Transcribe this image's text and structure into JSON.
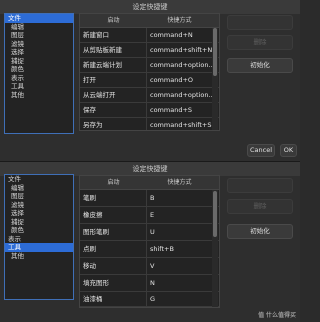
{
  "dialog1": {
    "title": "设定快捷键",
    "categories": [
      "文件",
      "编辑",
      "图层",
      "滤镜",
      "选择",
      "捕捉",
      "颜色",
      "表示",
      "工具",
      "其他"
    ],
    "header": {
      "col1": "启动",
      "col2": "快捷方式"
    },
    "rows": [
      {
        "action": "新建窗口",
        "shortcut": "command+N"
      },
      {
        "action": "从剪贴板新建",
        "shortcut": "command+shift+N"
      },
      {
        "action": "新建云端计划",
        "shortcut": "command+option..."
      },
      {
        "action": "打开",
        "shortcut": "command+O"
      },
      {
        "action": "从云端打开",
        "shortcut": "command+option..."
      },
      {
        "action": "保存",
        "shortcut": "command+S"
      },
      {
        "action": "另存为",
        "shortcut": "command+shift+S"
      }
    ],
    "buttons": {
      "b1": "",
      "b2": "删除",
      "init": "初始化",
      "cancel": "Cancel",
      "ok": "OK"
    }
  },
  "dialog2": {
    "title": "设定快捷键",
    "categories": [
      "文件",
      "编辑",
      "图层",
      "滤镜",
      "选择",
      "捕捉",
      "颜色",
      "表示",
      "工具",
      "其他"
    ],
    "header": {
      "col1": "启动",
      "col2": "快捷方式"
    },
    "rows": [
      {
        "action": "笔刷",
        "shortcut": "B"
      },
      {
        "action": "橡皮擦",
        "shortcut": "E"
      },
      {
        "action": "图形笔刷",
        "shortcut": "U"
      },
      {
        "action": "点刷",
        "shortcut": "shift+B"
      },
      {
        "action": "移动",
        "shortcut": "V"
      },
      {
        "action": "填充图形",
        "shortcut": "N"
      },
      {
        "action": "油漆桶",
        "shortcut": "G"
      }
    ],
    "buttons": {
      "b1": "",
      "b2": "删除",
      "init": "初始化"
    },
    "watermark": "值 什么值得买"
  }
}
